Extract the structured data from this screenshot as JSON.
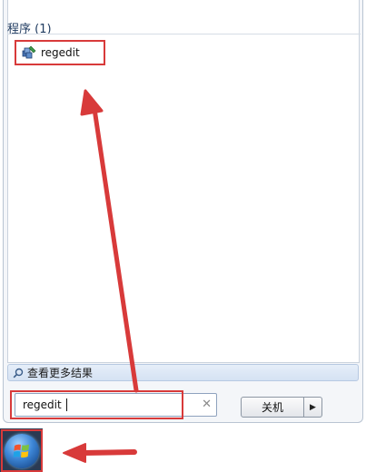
{
  "start_menu": {
    "results_header": "程序 (1)",
    "results": [
      {
        "label": "regedit",
        "icon": "regedit-icon"
      }
    ],
    "see_more_label": "查看更多结果",
    "search": {
      "value": "regedit",
      "clear_icon": "close-icon"
    },
    "shutdown_label": "关机",
    "shutdown_arrow_icon": "triangle-right-icon"
  },
  "taskbar": {
    "start_button_icon": "windows-logo-icon"
  },
  "annotation_color": "#d83a3a"
}
